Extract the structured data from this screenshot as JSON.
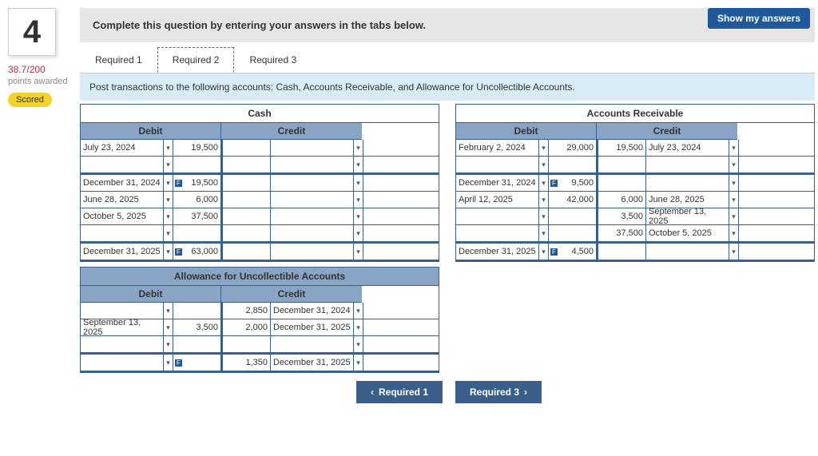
{
  "showAnswers": "Show my answers",
  "questionNumber": "4",
  "points": "38.7/200",
  "pointsLabel": "points awarded",
  "scored": "Scored",
  "instruction": "Complete this question by entering your answers in the tabs below.",
  "tabs": [
    "Required 1",
    "Required 2",
    "Required 3"
  ],
  "activeTab": 1,
  "subInstruction": "Post transactions to the following accounts: Cash, Accounts Receivable, and Allowance for Uncollectible Accounts.",
  "hdrDebit": "Debit",
  "hdrCredit": "Credit",
  "cash": {
    "title": "Cash",
    "rows": [
      {
        "dDate": "July 23, 2024",
        "dAmt": "19,500",
        "cAmt": "",
        "cDate": ""
      },
      {
        "dDate": "",
        "dAmt": "",
        "cAmt": "",
        "cDate": ""
      }
    ],
    "rows2": [
      {
        "dDate": "December 31, 2024",
        "dAmt": "19,500",
        "cAmt": "",
        "cDate": "",
        "flag": true
      },
      {
        "dDate": "June 28, 2025",
        "dAmt": "6,000",
        "cAmt": "",
        "cDate": ""
      },
      {
        "dDate": "October 5, 2025",
        "dAmt": "37,500",
        "cAmt": "",
        "cDate": ""
      },
      {
        "dDate": "",
        "dAmt": "",
        "cAmt": "",
        "cDate": ""
      }
    ],
    "total": {
      "dDate": "December 31, 2025",
      "dAmt": "63,000",
      "cAmt": "",
      "cDate": "",
      "flag": true
    }
  },
  "ar": {
    "title": "Accounts Receivable",
    "rows": [
      {
        "dDate": "February 2, 2024",
        "dAmt": "29,000",
        "cAmt": "19,500",
        "cDate": "July 23, 2024"
      },
      {
        "dDate": "",
        "dAmt": "",
        "cAmt": "",
        "cDate": ""
      }
    ],
    "rows2": [
      {
        "dDate": "December 31, 2024",
        "dAmt": "9,500",
        "cAmt": "",
        "cDate": "",
        "flag": true
      },
      {
        "dDate": "April 12, 2025",
        "dAmt": "42,000",
        "cAmt": "6,000",
        "cDate": "June 28, 2025"
      },
      {
        "dDate": "",
        "dAmt": "",
        "cAmt": "3,500",
        "cDate": "September 13, 2025"
      },
      {
        "dDate": "",
        "dAmt": "",
        "cAmt": "37,500",
        "cDate": "October 5, 2025"
      }
    ],
    "total": {
      "dDate": "December 31, 2025",
      "dAmt": "4,500",
      "cAmt": "",
      "cDate": "",
      "flag": true
    }
  },
  "allowance": {
    "title": "Allowance for Uncollectible Accounts",
    "rows": [
      {
        "dDate": "",
        "dAmt": "",
        "cAmt": "2,850",
        "cDate": "December 31, 2024"
      },
      {
        "dDate": "September 13, 2025",
        "dAmt": "3,500",
        "cAmt": "2,000",
        "cDate": "December 31, 2025"
      },
      {
        "dDate": "",
        "dAmt": "",
        "cAmt": "",
        "cDate": ""
      }
    ],
    "total": {
      "dDate": "",
      "dAmt": "",
      "cAmt": "1,350",
      "cDate": "December 31, 2025",
      "flag": true
    }
  },
  "navPrev": "Required 1",
  "navNext": "Required 3"
}
